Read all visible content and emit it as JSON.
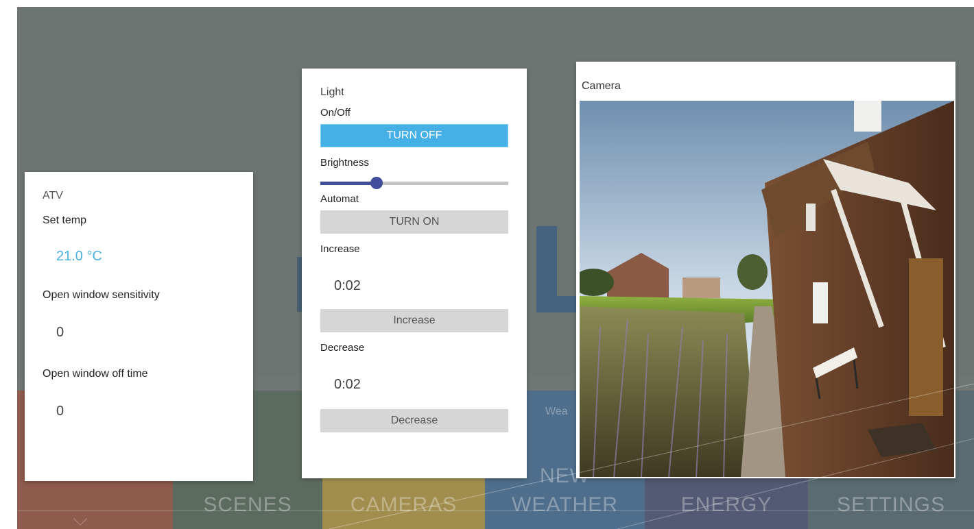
{
  "background": {
    "tiles": [
      {
        "id": "lights",
        "label": ""
      },
      {
        "id": "scenes",
        "label": "SCENES"
      },
      {
        "id": "cameras",
        "label": "CAMERAS"
      },
      {
        "id": "weather",
        "label": "WEATHER"
      },
      {
        "id": "energy",
        "label": "ENERGY"
      },
      {
        "id": "settings",
        "label": "SETTINGS"
      }
    ],
    "weather_top_label": "NEW",
    "weather_small_text": "Wea"
  },
  "atv": {
    "title": "ATV",
    "set_temp_label": "Set temp",
    "set_temp_value": "21.0 °C",
    "sensitivity_label": "Open window sensitivity",
    "sensitivity_value": "0",
    "off_time_label": "Open window off time",
    "off_time_value": "0"
  },
  "light": {
    "title": "Light",
    "onoff_label": "On/Off",
    "onoff_button": "TURN OFF",
    "brightness_label": "Brightness",
    "brightness_value": 0.3,
    "automat_label": "Automat",
    "automat_button": "TURN ON",
    "increase_label": "Increase",
    "increase_value": "0:02",
    "increase_button": "Increase",
    "decrease_label": "Decrease",
    "decrease_value": "0:02",
    "decrease_button": "Decrease"
  },
  "camera": {
    "title": "Camera"
  },
  "colors": {
    "accent_blue": "#45b0e6",
    "temp_blue": "#4ab0e0",
    "slider_blue": "#3f4d9a"
  }
}
